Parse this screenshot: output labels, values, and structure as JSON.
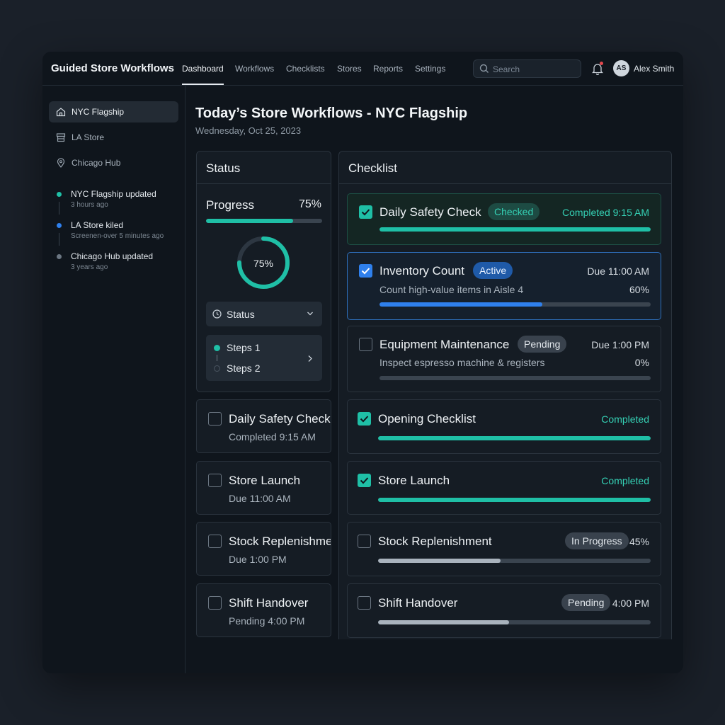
{
  "app": {
    "title": "Guided Store Workflows"
  },
  "nav": {
    "links": [
      "Dashboard",
      "Workflows",
      "Checklists",
      "Stores",
      "Reports",
      "Settings"
    ],
    "active": "Dashboard"
  },
  "search": {
    "placeholder": "Search"
  },
  "user": {
    "initials": "AS",
    "name": "Alex Smith",
    "has_notification": true
  },
  "sidebar": {
    "stores": [
      {
        "label": "NYC Flagship",
        "icon": "home-icon",
        "active": true
      },
      {
        "label": "LA Store",
        "icon": "storefront-icon",
        "active": false
      },
      {
        "label": "Chicago Hub",
        "icon": "map-pin-icon",
        "active": false
      }
    ],
    "activity": [
      {
        "title": "NYC Flagship updated",
        "time": "3 hours ago",
        "color": "#1fbfa6"
      },
      {
        "title": "LA Store kiled",
        "time": "Screenen-over 5 minutes ago",
        "color": "#2f80ed"
      },
      {
        "title": "Chicago Hub updated",
        "time": "3 years ago",
        "color": "#6b7682"
      }
    ]
  },
  "main": {
    "title": "Today’s Store Workflows - NYC Flagship",
    "date": "Wednesday, Oct 25, 2023"
  },
  "status_panel": {
    "heading": "Status",
    "progress_label": "Progress",
    "progress_pct_text": "75%",
    "progress_value": 0.75,
    "donut_label": "75%",
    "select_label": "Status",
    "steps": [
      "Steps 1",
      "Steps 2"
    ]
  },
  "left_cards": [
    {
      "title": "Daily Safety Check",
      "sub": "Completed 9:15 AM"
    },
    {
      "title": "Store Launch",
      "sub": "Due 11:00 AM"
    },
    {
      "title": "Stock Replenishment",
      "sub": "Due 1:00 PM"
    },
    {
      "title": "Shift Handover",
      "sub": "Pending 4:00 PM"
    }
  ],
  "checklist": {
    "heading": "Checklist",
    "items": [
      {
        "title": "Daily Safety Check",
        "badge": "Checked",
        "right": "Completed 9:15 AM",
        "progress": 1.0,
        "color": "#1fbfa6"
      },
      {
        "title": "Inventory Count",
        "badge": "Active",
        "right": "Due 11:00 AM",
        "sub": "Count high-value items in Aisle 4",
        "pct": "60%",
        "progress": 0.6,
        "color": "#2f80ed"
      },
      {
        "title": "Equipment Maintenance",
        "badge": "Pending",
        "right": "Due 1:00 PM",
        "sub": "Inspect espresso machine & registers",
        "pct": "0%",
        "progress": 0.0,
        "color": "#5b6672"
      },
      {
        "title": "Opening Checklist",
        "right": "Completed",
        "progress": 1.0,
        "color": "#1fbfa6"
      },
      {
        "title": "Store Launch",
        "right": "Completed",
        "progress": 1.0,
        "color": "#1fbfa6"
      },
      {
        "title": "Stock Replenishment",
        "badge": "In Progress",
        "pct": "45%",
        "progress": 0.45,
        "color": "#a9b3bd"
      },
      {
        "title": "Shift Handover",
        "badge": "Pending",
        "right": "4:00 PM",
        "progress": 0.48,
        "color": "#a9b3bd"
      }
    ]
  },
  "colors": {
    "accent": "#1fbfa6",
    "active": "#2f80ed",
    "background": "#0f151c"
  }
}
